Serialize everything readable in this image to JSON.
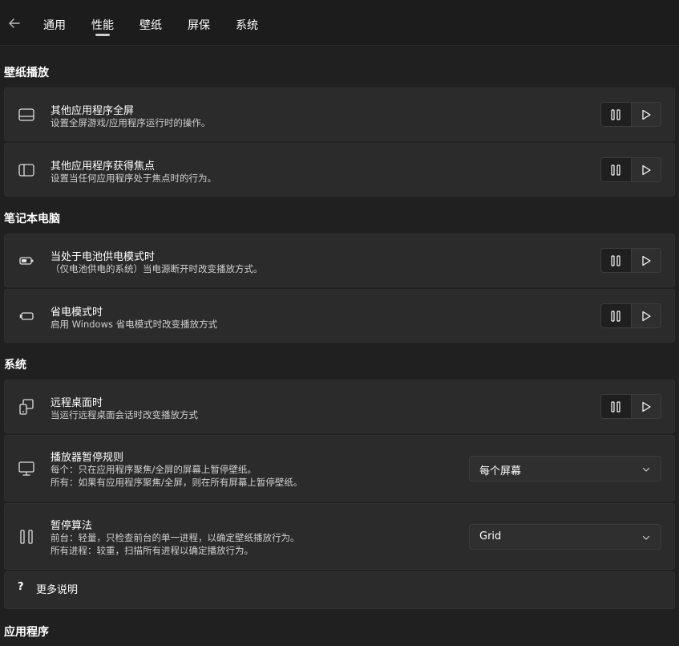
{
  "nav": {
    "back_icon": "back-arrow-icon",
    "tabs": [
      {
        "label": "通用"
      },
      {
        "label": "性能",
        "selected": true
      },
      {
        "label": "壁纸"
      },
      {
        "label": "屏保"
      },
      {
        "label": "系统"
      }
    ]
  },
  "sections": {
    "wallpaper_playback": {
      "title": "壁纸播放",
      "items": [
        {
          "title": "其他应用程序全屏",
          "desc": "设置全屏游戏/应用程序运行时的操作。",
          "icon": "fullscreen-window-icon"
        },
        {
          "title": "其他应用程序获得焦点",
          "desc": "设置当任何应用程序处于焦点时的行为。",
          "icon": "focused-window-icon"
        }
      ]
    },
    "laptop": {
      "title": "笔记本电脑",
      "items": [
        {
          "title": "当处于电池供电模式时",
          "desc": "（仅电池供电的系统）当电源断开时改变播放方式。",
          "icon": "battery-icon"
        },
        {
          "title": "省电模式时",
          "desc": "启用 Windows 省电模式时改变播放方式",
          "icon": "battery-saver-icon"
        }
      ]
    },
    "system": {
      "title": "系统",
      "remote": {
        "title": "远程桌面时",
        "desc": "当运行远程桌面会话时改变播放方式",
        "icon": "remote-desktop-icon"
      },
      "pause_rule": {
        "title": "播放器暂停规则",
        "desc1": "每个：只在应用程序聚焦/全屏的屏幕上暂停壁纸。",
        "desc2": "所有：如果有应用程序聚焦/全屏，则在所有屏幕上暂停壁纸。",
        "icon": "monitor-icon",
        "value": "每个屏幕"
      },
      "pause_algo": {
        "title": "暂停算法",
        "desc1": "前台：轻量，只检查前台的单一进程，以确定壁纸播放行为。",
        "desc2": "所有进程：较重，扫描所有进程以确定播放行为。",
        "icon": "pause-icon",
        "value": "Grid"
      },
      "help": {
        "mark": "?",
        "label": "更多说明"
      }
    },
    "applications": {
      "title": "应用程序"
    }
  },
  "segmented_icons": {
    "pause": "pause-icon",
    "play": "play-icon"
  },
  "colors": {
    "background": "#202020",
    "card": "#2b2b2b",
    "selected_segment": "#1f1f1f"
  }
}
